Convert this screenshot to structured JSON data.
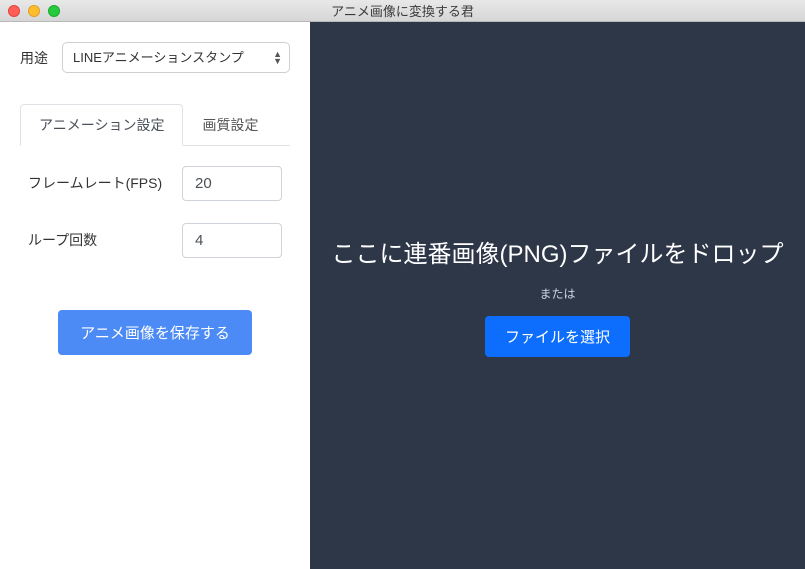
{
  "window": {
    "title": "アニメ画像に変換する君"
  },
  "left": {
    "purpose_label": "用途",
    "purpose_selected": "LINEアニメーションスタンプ",
    "tabs": {
      "animation": "アニメーション設定",
      "quality": "画質設定"
    },
    "framerate_label": "フレームレート(FPS)",
    "framerate_value": "20",
    "loop_label": "ループ回数",
    "loop_value": "4",
    "save_button": "アニメ画像を保存する"
  },
  "right": {
    "drop_text": "ここに連番画像(PNG)ファイルをドロップ",
    "or_text": "または",
    "select_button": "ファイルを選択"
  }
}
